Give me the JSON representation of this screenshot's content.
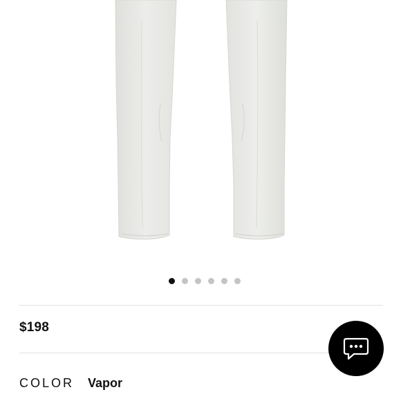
{
  "product": {
    "price": "$198",
    "color_label": "COLOR",
    "color_value": "Vapor"
  },
  "carousel": {
    "total_slides": 6,
    "active_index": 0
  },
  "chat": {
    "icon": "chat-bubble-icon"
  },
  "colors": {
    "background": "#ffffff",
    "text": "#111111",
    "dot_active": "#111111",
    "dot_inactive": "#c4c4c4",
    "chat_button": "#000000",
    "pants": "#e9eae6"
  }
}
